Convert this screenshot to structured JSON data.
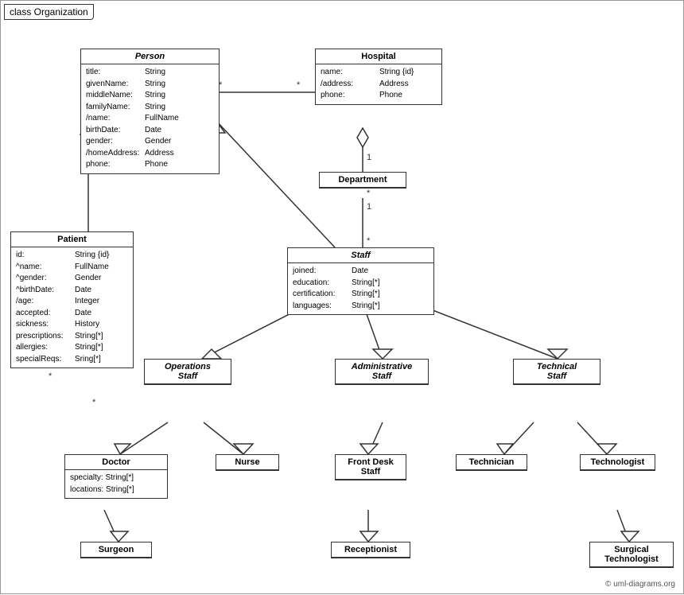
{
  "title": "class Organization",
  "copyright": "© uml-diagrams.org",
  "classes": {
    "person": {
      "name": "Person",
      "italic": true,
      "attrs": [
        [
          "title:",
          "String"
        ],
        [
          "givenName:",
          "String"
        ],
        [
          "middleName:",
          "String"
        ],
        [
          "familyName:",
          "String"
        ],
        [
          "/name:",
          "FullName"
        ],
        [
          "birthDate:",
          "Date"
        ],
        [
          "gender:",
          "Gender"
        ],
        [
          "/homeAddress:",
          "Address"
        ],
        [
          "phone:",
          "Phone"
        ]
      ]
    },
    "hospital": {
      "name": "Hospital",
      "italic": false,
      "attrs": [
        [
          "name:",
          "String {id}"
        ],
        [
          "/address:",
          "Address"
        ],
        [
          "phone:",
          "Phone"
        ]
      ]
    },
    "department": {
      "name": "Department",
      "italic": false,
      "attrs": []
    },
    "staff": {
      "name": "Staff",
      "italic": true,
      "attrs": [
        [
          "joined:",
          "Date"
        ],
        [
          "education:",
          "String[*]"
        ],
        [
          "certification:",
          "String[*]"
        ],
        [
          "languages:",
          "String[*]"
        ]
      ]
    },
    "patient": {
      "name": "Patient",
      "italic": false,
      "attrs": [
        [
          "id:",
          "String {id}"
        ],
        [
          "^name:",
          "FullName"
        ],
        [
          "^gender:",
          "Gender"
        ],
        [
          "^birthDate:",
          "Date"
        ],
        [
          "/age:",
          "Integer"
        ],
        [
          "accepted:",
          "Date"
        ],
        [
          "sickness:",
          "History"
        ],
        [
          "prescriptions:",
          "String[*]"
        ],
        [
          "allergies:",
          "String[*]"
        ],
        [
          "specialReqs:",
          "Sring[*]"
        ]
      ]
    },
    "operationsStaff": {
      "name": "Operations Staff",
      "italic": true,
      "attrs": []
    },
    "administrativeStaff": {
      "name": "Administrative Staff",
      "italic": true,
      "attrs": []
    },
    "technicalStaff": {
      "name": "Technical Staff",
      "italic": true,
      "attrs": []
    },
    "doctor": {
      "name": "Doctor",
      "italic": false,
      "attrs": [
        [
          "specialty:",
          "String[*]"
        ],
        [
          "locations:",
          "String[*]"
        ]
      ]
    },
    "nurse": {
      "name": "Nurse",
      "italic": false,
      "attrs": []
    },
    "frontDeskStaff": {
      "name": "Front Desk Staff",
      "italic": false,
      "attrs": []
    },
    "technician": {
      "name": "Technician",
      "italic": false,
      "attrs": []
    },
    "technologist": {
      "name": "Technologist",
      "italic": false,
      "attrs": []
    },
    "surgeon": {
      "name": "Surgeon",
      "italic": false,
      "attrs": []
    },
    "receptionist": {
      "name": "Receptionist",
      "italic": false,
      "attrs": []
    },
    "surgicalTechnologist": {
      "name": "Surgical Technologist",
      "italic": false,
      "attrs": []
    }
  }
}
